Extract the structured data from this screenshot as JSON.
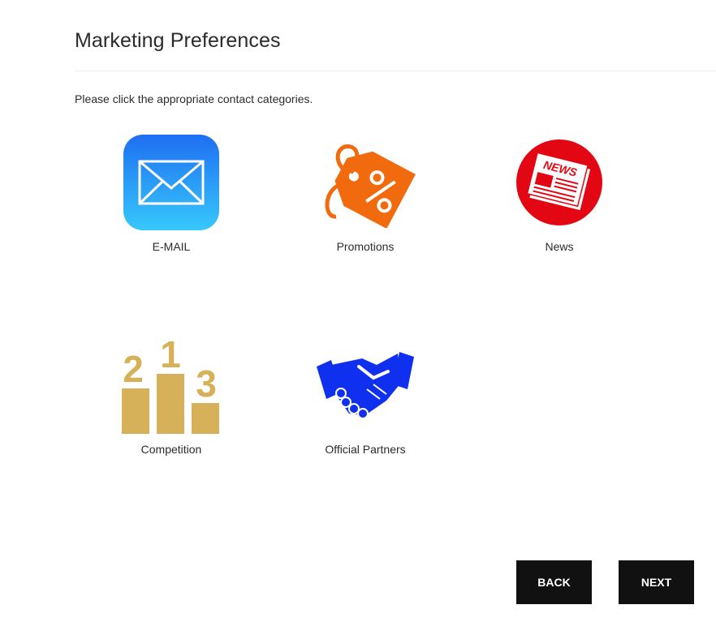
{
  "page": {
    "title": "Marketing Preferences",
    "instruction": "Please click the appropriate contact categories."
  },
  "categories": [
    {
      "label": "E-MAIL",
      "icon": "envelope-icon"
    },
    {
      "label": "Promotions",
      "icon": "percent-tag-icon"
    },
    {
      "label": "News",
      "icon": "newspaper-icon"
    },
    {
      "label": "Competition",
      "icon": "podium-icon"
    },
    {
      "label": "Official Partners",
      "icon": "handshake-icon"
    }
  ],
  "icon_texts": {
    "news_badge": "NEWS",
    "podium_1": "1",
    "podium_2": "2",
    "podium_3": "3"
  },
  "buttons": {
    "back": "BACK",
    "next": "NEXT"
  },
  "colors": {
    "email_gradient_top": "#1e6ff2",
    "email_gradient_bottom": "#37c8fb",
    "promotions": "#f26a0e",
    "news": "#e30613",
    "competition": "#d6b15a",
    "partners": "#1030f0",
    "button_bg": "#111111"
  }
}
